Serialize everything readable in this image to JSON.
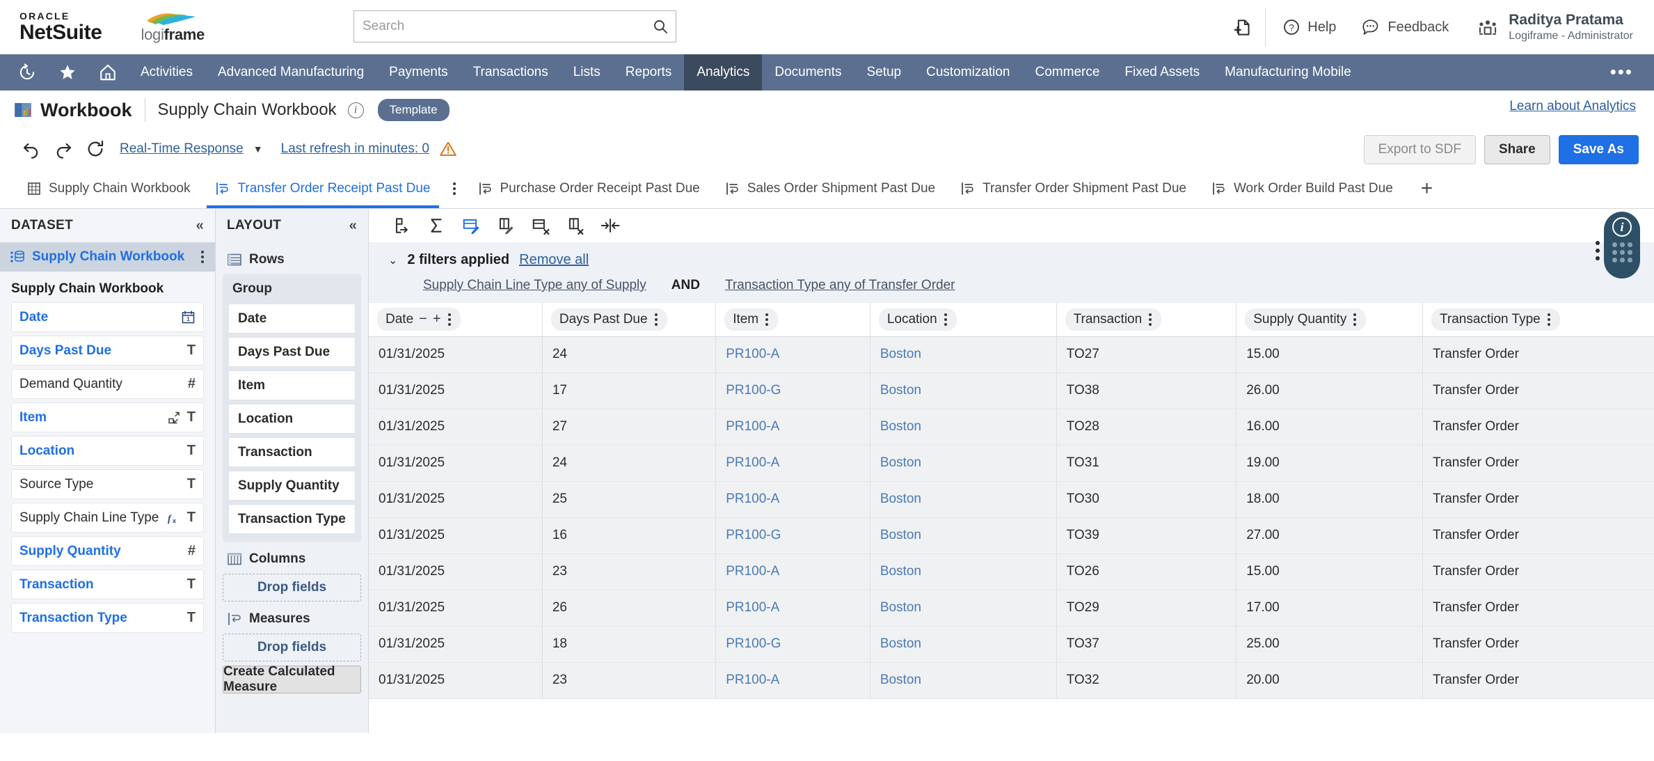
{
  "topbar": {
    "oracle_word": "ORACLE",
    "netsuite_word": "NetSuite",
    "brand_logo_prefix": "logi",
    "brand_logo_suffix": "frame",
    "search_placeholder": "Search",
    "search_value": "",
    "help_label": "Help",
    "feedback_label": "Feedback",
    "user_name": "Raditya Pratama",
    "user_role": "Logiframe - Administrator"
  },
  "nav": {
    "items": [
      {
        "label": "Activities",
        "active": false
      },
      {
        "label": "Advanced Manufacturing",
        "active": false
      },
      {
        "label": "Payments",
        "active": false
      },
      {
        "label": "Transactions",
        "active": false
      },
      {
        "label": "Lists",
        "active": false
      },
      {
        "label": "Reports",
        "active": false
      },
      {
        "label": "Analytics",
        "active": true
      },
      {
        "label": "Documents",
        "active": false
      },
      {
        "label": "Setup",
        "active": false
      },
      {
        "label": "Customization",
        "active": false
      },
      {
        "label": "Commerce",
        "active": false
      },
      {
        "label": "Fixed Assets",
        "active": false
      },
      {
        "label": "Manufacturing Mobile",
        "active": false
      }
    ],
    "more_label": "•••"
  },
  "workbook_header": {
    "title": "Workbook",
    "name": "Supply Chain Workbook",
    "badge": "Template",
    "learn_link": "Learn about Analytics"
  },
  "action_bar": {
    "response_mode": "Real-Time Response",
    "refresh_status": "Last refresh in minutes: 0",
    "export_label": "Export to SDF",
    "share_label": "Share",
    "save_as_label": "Save As"
  },
  "tabs": [
    {
      "label": "Supply Chain Workbook",
      "icon": "table-icon",
      "active": false
    },
    {
      "label": "Transfer Order Receipt Past Due",
      "icon": "pivot-icon",
      "active": true
    },
    {
      "label": "Purchase Order Receipt Past Due",
      "icon": "pivot-icon",
      "active": false
    },
    {
      "label": "Sales Order Shipment Past Due",
      "icon": "pivot-icon",
      "active": false
    },
    {
      "label": "Transfer Order Shipment Past Due",
      "icon": "pivot-icon",
      "active": false
    },
    {
      "label": "Work Order Build Past Due",
      "icon": "pivot-icon",
      "active": false
    }
  ],
  "tab_add_label": "+",
  "dataset_panel": {
    "title": "DATASET",
    "collapse": "«",
    "selected_dataset": "Supply Chain Workbook",
    "group_title": "Supply Chain Workbook",
    "fields": [
      {
        "name": "Date",
        "type": "calendar-icon",
        "link": true,
        "extra": ""
      },
      {
        "name": "Days Past Due",
        "type": "T",
        "link": true,
        "extra": ""
      },
      {
        "name": "Demand Quantity",
        "type": "#",
        "link": false,
        "extra": ""
      },
      {
        "name": "Item",
        "type": "T",
        "link": true,
        "extra": "join-icon"
      },
      {
        "name": "Location",
        "type": "T",
        "link": true,
        "extra": ""
      },
      {
        "name": "Source Type",
        "type": "T",
        "link": false,
        "extra": ""
      },
      {
        "name": "Supply Chain Line Type",
        "type": "T",
        "link": false,
        "extra": "fx-icon"
      },
      {
        "name": "Supply Quantity",
        "type": "#",
        "link": true,
        "extra": ""
      },
      {
        "name": "Transaction",
        "type": "T",
        "link": true,
        "extra": ""
      },
      {
        "name": "Transaction Type",
        "type": "T",
        "link": true,
        "extra": ""
      }
    ]
  },
  "layout_panel": {
    "title": "LAYOUT",
    "collapse": "«",
    "rows_label": "Rows",
    "group_label": "Group",
    "row_fields": [
      "Date",
      "Days Past Due",
      "Item",
      "Location",
      "Transaction",
      "Supply Quantity",
      "Transaction Type"
    ],
    "columns_label": "Columns",
    "columns_drop": "Drop fields",
    "measures_label": "Measures",
    "measures_drop": "Drop fields",
    "create_measure_label": "Create Calculated Measure"
  },
  "filters": {
    "summary": "2 filters applied",
    "remove_all": "Remove all",
    "conditions": [
      "Supply Chain Line Type any of Supply",
      "Transaction Type any of Transfer Order"
    ],
    "operator": "AND"
  },
  "table": {
    "columns": [
      {
        "label": "Date",
        "has_expand": true
      },
      {
        "label": "Days Past Due",
        "has_expand": false
      },
      {
        "label": "Item",
        "has_expand": false
      },
      {
        "label": "Location",
        "has_expand": false
      },
      {
        "label": "Transaction",
        "has_expand": false
      },
      {
        "label": "Supply Quantity",
        "has_expand": false
      },
      {
        "label": "Transaction Type",
        "has_expand": false
      }
    ],
    "rows": [
      [
        "01/31/2025",
        "24",
        "PR100-A",
        "Boston",
        "TO27",
        "15.00",
        "Transfer Order"
      ],
      [
        "01/31/2025",
        "17",
        "PR100-G",
        "Boston",
        "TO38",
        "26.00",
        "Transfer Order"
      ],
      [
        "01/31/2025",
        "27",
        "PR100-A",
        "Boston",
        "TO28",
        "16.00",
        "Transfer Order"
      ],
      [
        "01/31/2025",
        "24",
        "PR100-A",
        "Boston",
        "TO31",
        "19.00",
        "Transfer Order"
      ],
      [
        "01/31/2025",
        "25",
        "PR100-A",
        "Boston",
        "TO30",
        "18.00",
        "Transfer Order"
      ],
      [
        "01/31/2025",
        "16",
        "PR100-G",
        "Boston",
        "TO39",
        "27.00",
        "Transfer Order"
      ],
      [
        "01/31/2025",
        "23",
        "PR100-A",
        "Boston",
        "TO26",
        "15.00",
        "Transfer Order"
      ],
      [
        "01/31/2025",
        "26",
        "PR100-A",
        "Boston",
        "TO29",
        "17.00",
        "Transfer Order"
      ],
      [
        "01/31/2025",
        "18",
        "PR100-G",
        "Boston",
        "TO37",
        "25.00",
        "Transfer Order"
      ],
      [
        "01/31/2025",
        "23",
        "PR100-A",
        "Boston",
        "TO32",
        "20.00",
        "Transfer Order"
      ]
    ],
    "link_columns": [
      2,
      3
    ]
  },
  "colors": {
    "nav_bg": "#5b7091",
    "nav_active": "#3c4a5e",
    "link_blue": "#1f6fe5",
    "primary_btn": "#1f6fe5",
    "panel_bg": "#f3f5f8",
    "row_bg": "#f0f1f3"
  }
}
